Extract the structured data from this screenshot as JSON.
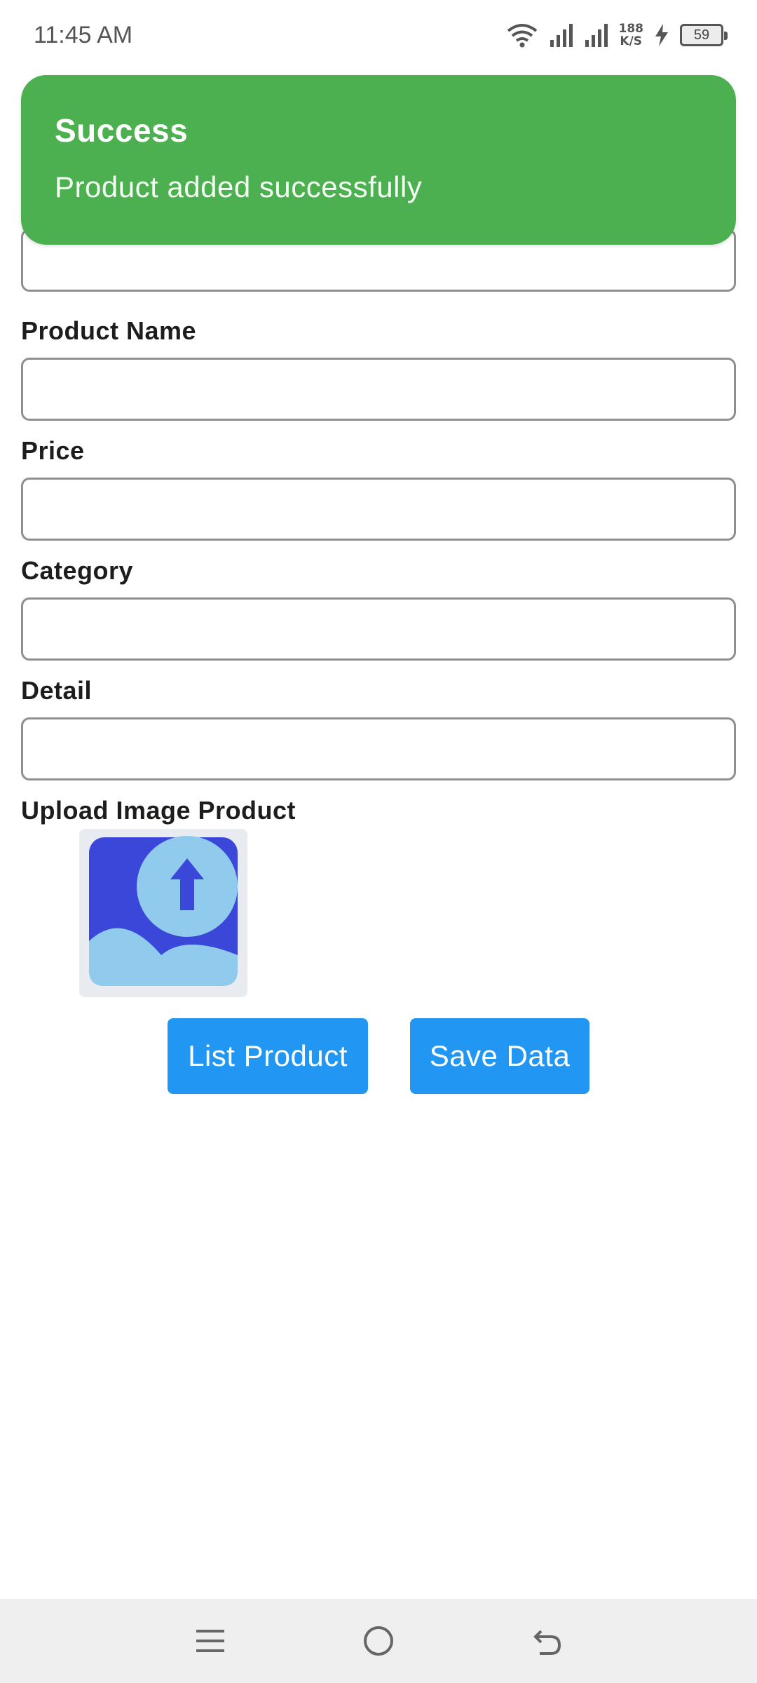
{
  "status_bar": {
    "time": "11:45 AM",
    "net_speed_value": "188",
    "net_speed_unit": "K/S",
    "battery_level": "59",
    "icons": [
      "wifi-icon",
      "signal-icon",
      "signal-icon",
      "charging-icon",
      "battery-icon"
    ]
  },
  "snackbar": {
    "title": "Success",
    "message": "Product added successfully",
    "color": "#4caf50"
  },
  "form": {
    "top_field_value": "",
    "fields": [
      {
        "label": "Product Name",
        "value": ""
      },
      {
        "label": "Price",
        "value": ""
      },
      {
        "label": "Category",
        "value": ""
      },
      {
        "label": "Detail",
        "value": ""
      }
    ],
    "upload_label": "Upload Image Product",
    "upload_icon": "image-upload-icon"
  },
  "buttons": {
    "list_label": "List Product",
    "save_label": "Save Data",
    "color": "#2196f3"
  },
  "nav_bar": {
    "icons": [
      "menu-icon",
      "home-icon",
      "back-icon"
    ]
  }
}
